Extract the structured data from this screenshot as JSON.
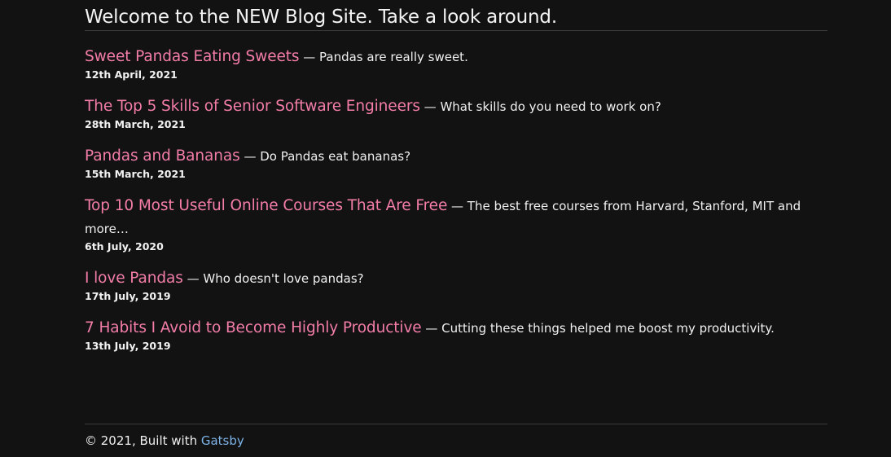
{
  "header": {
    "title": "Welcome to the NEW Blog Site. Take a look around."
  },
  "posts": [
    {
      "title": "Sweet Pandas Eating Sweets",
      "separator": " — ",
      "description": "Pandas are really sweet.",
      "date": "12th April, 2021"
    },
    {
      "title": "The Top 5 Skills of Senior Software Engineers",
      "separator": " — ",
      "description": "What skills do you need to work on?",
      "date": "28th March, 2021"
    },
    {
      "title": "Pandas and Bananas",
      "separator": " — ",
      "description": "Do Pandas eat bananas?",
      "date": "15th March, 2021"
    },
    {
      "title": "Top 10 Most Useful Online Courses That Are Free",
      "separator": " — ",
      "description": "The best free courses from Harvard, Stanford, MIT and more…",
      "date": "6th July, 2020"
    },
    {
      "title": "I love Pandas",
      "separator": " — ",
      "description": "Who doesn't love pandas?",
      "date": "17th July, 2019"
    },
    {
      "title": "7 Habits I Avoid to Become Highly Productive",
      "separator": " — ",
      "description": "Cutting these things helped me boost my productivity.",
      "date": "13th July, 2019"
    }
  ],
  "footer": {
    "prefix": "© 2021, Built with ",
    "link_label": "Gatsby"
  },
  "colors": {
    "background": "#121213",
    "post_title": "#f37da6",
    "footer_link": "#7db3e6"
  }
}
